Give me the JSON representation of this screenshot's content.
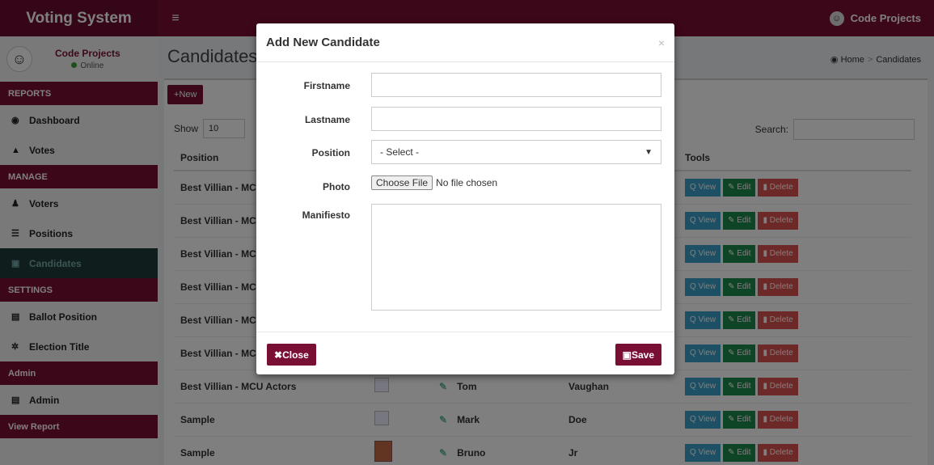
{
  "header": {
    "brand": "Voting System",
    "menu_icon": "≡",
    "user_name": "Code Projects"
  },
  "sidebar": {
    "user_name": "Code Projects",
    "status": "Online",
    "sections": {
      "reports": "REPORTS",
      "manage": "MANAGE",
      "settings": "SETTINGS",
      "admin": "Admin",
      "view_report": "View Report"
    },
    "items": {
      "dashboard": "Dashboard",
      "votes": "Votes",
      "voters": "Voters",
      "positions": "Positions",
      "candidates": "Candidates",
      "ballot_position": "Ballot Position",
      "election_title": "Election Title",
      "admin": "Admin"
    }
  },
  "content": {
    "title": "Candidates",
    "breadcrumb": {
      "home": "Home",
      "current": "Candidates"
    },
    "new_button": "New",
    "show_label": "Show",
    "show_value": "10",
    "search_label": "Search:",
    "columns": {
      "position": "Position",
      "tools": "Tools"
    },
    "rows": [
      {
        "position": "Best Villian - MC",
        "firstname": "",
        "lastname": ""
      },
      {
        "position": "Best Villian - MC",
        "firstname": "",
        "lastname": ""
      },
      {
        "position": "Best Villian - MC",
        "firstname": "",
        "lastname": ""
      },
      {
        "position": "Best Villian - MC",
        "firstname": "",
        "lastname": ""
      },
      {
        "position": "Best Villian - MC",
        "firstname": "",
        "lastname": ""
      },
      {
        "position": "Best Villian - MC",
        "firstname": "",
        "lastname": ""
      },
      {
        "position": "Best Villian - MCU Actors",
        "firstname": "Tom",
        "lastname": "Vaughan"
      },
      {
        "position": "Sample",
        "firstname": "Mark",
        "lastname": "Doe"
      },
      {
        "position": "Sample",
        "firstname": "Bruno",
        "lastname": "Jr"
      }
    ],
    "tools": {
      "view": "Q View",
      "edit": "Edit",
      "delete": "Delete"
    }
  },
  "modal": {
    "title": "Add New Candidate",
    "close_icon": "×",
    "labels": {
      "firstname": "Firstname",
      "lastname": "Lastname",
      "position": "Position",
      "photo": "Photo",
      "manifesto": "Manifiesto"
    },
    "position_selected": "- Select -",
    "file_button": "Choose File",
    "file_status": "No file chosen",
    "close_button": "Close",
    "save_button": "Save"
  },
  "colors": {
    "brand": "#7a0f35",
    "view": "#3aa0c8",
    "edit": "#1e8b4f",
    "delete": "#d9534f"
  }
}
